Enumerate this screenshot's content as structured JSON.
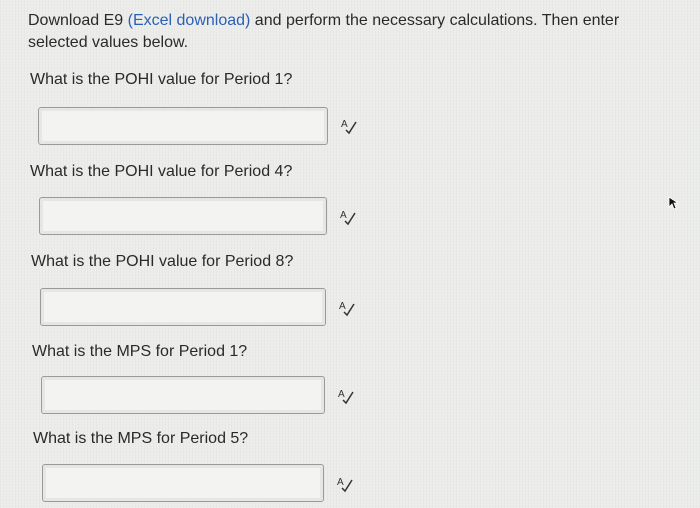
{
  "intro": {
    "prefix": "Download E9 ",
    "link_text": "(Excel download)",
    "suffix": " and perform the necessary calculations. Then enter selected values below."
  },
  "questions": [
    {
      "label": "What is the POHI value for Period 1?",
      "value": ""
    },
    {
      "label": "What is the POHI value for Period 4?",
      "value": ""
    },
    {
      "label": "What is the POHI value for Period 8?",
      "value": ""
    },
    {
      "label": "What is the MPS for Period 1?",
      "value": ""
    },
    {
      "label": "What is the MPS for Period 5?",
      "value": ""
    }
  ],
  "icons": {
    "spell_check": "spell-check-icon",
    "cursor": "mouse-cursor-icon"
  },
  "colors": {
    "link": "#2b5fb4",
    "text": "#2a2a2a"
  }
}
